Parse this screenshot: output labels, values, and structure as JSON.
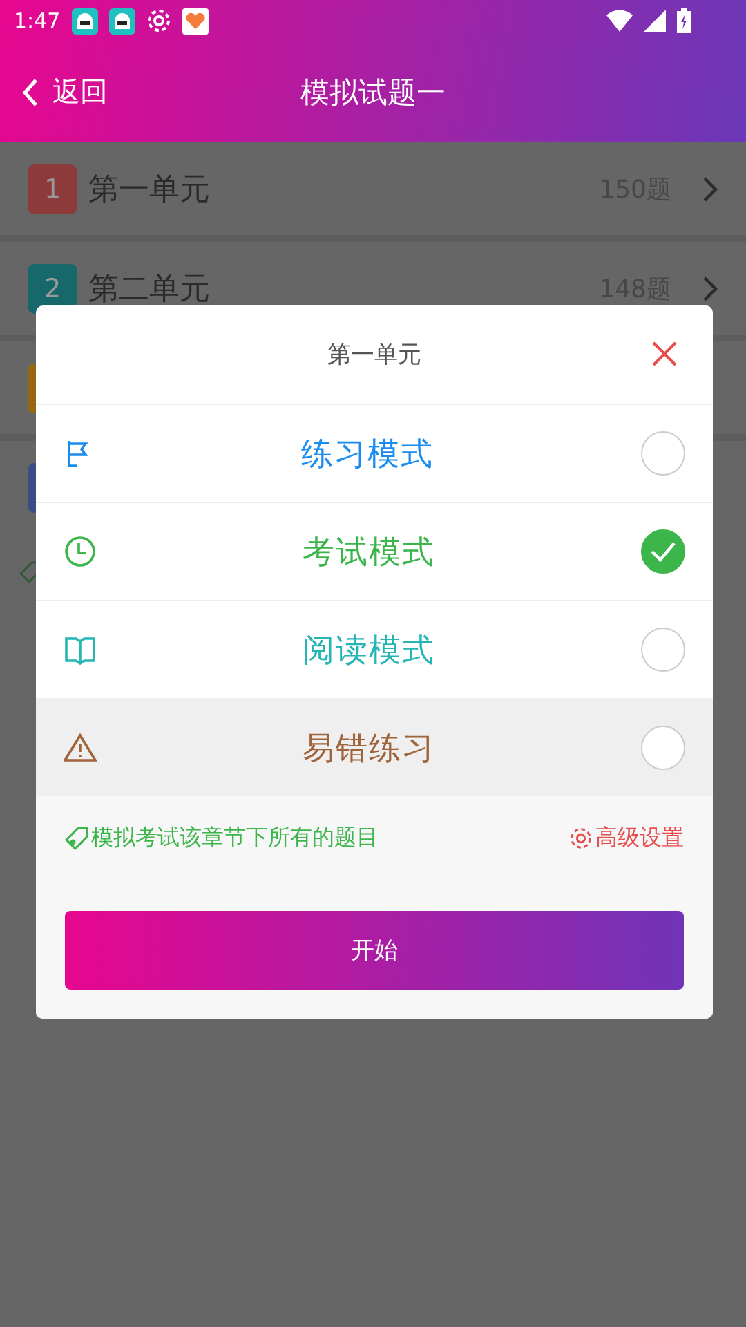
{
  "status_bar": {
    "time": "1:47"
  },
  "header": {
    "back": "返回",
    "title": "模拟试题一"
  },
  "units": [
    {
      "number": "1",
      "name": "第一单元",
      "count": "150题",
      "color": "#8c3a3a"
    },
    {
      "number": "2",
      "name": "第二单元",
      "count": "148题",
      "color": "#16686b"
    },
    {
      "color": "#946810"
    },
    {
      "color": "#3b4d86"
    }
  ],
  "dialog": {
    "title": "第一单元",
    "modes": [
      {
        "kind": "flag",
        "label": "练习模式",
        "color": "#1a8cf0",
        "selected": false,
        "highlighted": false
      },
      {
        "kind": "clock",
        "label": "考试模式",
        "color": "#3cb54a",
        "selected": true,
        "highlighted": false
      },
      {
        "kind": "book",
        "label": "阅读模式",
        "color": "#26b5b5",
        "selected": false,
        "highlighted": false
      },
      {
        "kind": "warning",
        "label": "易错练习",
        "color": "#a0643c",
        "selected": false,
        "highlighted": true
      }
    ],
    "hint": "模拟考试该章节下所有的题目",
    "settings": "高级设置",
    "start": "开始"
  }
}
